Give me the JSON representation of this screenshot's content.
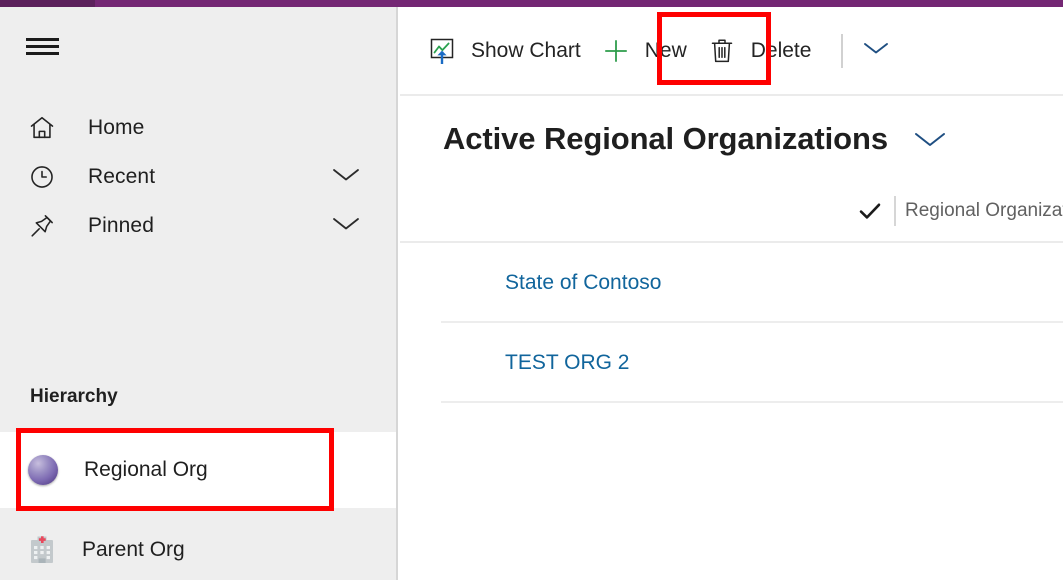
{
  "theme": {
    "brand_purple": "#742774",
    "brand_purple_dark": "#5c215c",
    "sidebar_bg": "#eeeeee",
    "selection_blue": "#0f6cbd",
    "link_blue": "#11659c",
    "annotation_red": "#fe0000",
    "new_icon_green": "#2d9c4a"
  },
  "sidebar": {
    "menu_button": "hamburger-menu",
    "items": [
      {
        "label": "Home",
        "icon": "home-icon",
        "has_chevron": false
      },
      {
        "label": "Recent",
        "icon": "clock-icon",
        "has_chevron": true
      },
      {
        "label": "Pinned",
        "icon": "pin-icon",
        "has_chevron": true
      }
    ],
    "section_title": "Hierarchy",
    "entities": [
      {
        "label": "Regional Org",
        "icon": "purple-sphere-icon",
        "selected": true
      },
      {
        "label": "Parent Org",
        "icon": "hospital-building-icon",
        "selected": false
      }
    ]
  },
  "commandbar": {
    "items": [
      {
        "label": "Show Chart",
        "icon": "chart-up-icon",
        "highlighted": false
      },
      {
        "label": "New",
        "icon": "plus-icon",
        "highlighted": true
      },
      {
        "label": "Delete",
        "icon": "trash-icon",
        "highlighted": false
      }
    ],
    "overflow_icon": "chevron-down-icon"
  },
  "view": {
    "title": "Active Regional Organizations",
    "title_chevron_icon": "chevron-down-icon"
  },
  "grid": {
    "select_all_icon": "checkmark-icon",
    "columns": [
      "Regional Organization Name"
    ],
    "rows": [
      {
        "name": "State of Contoso"
      },
      {
        "name": "TEST ORG 2"
      }
    ]
  }
}
